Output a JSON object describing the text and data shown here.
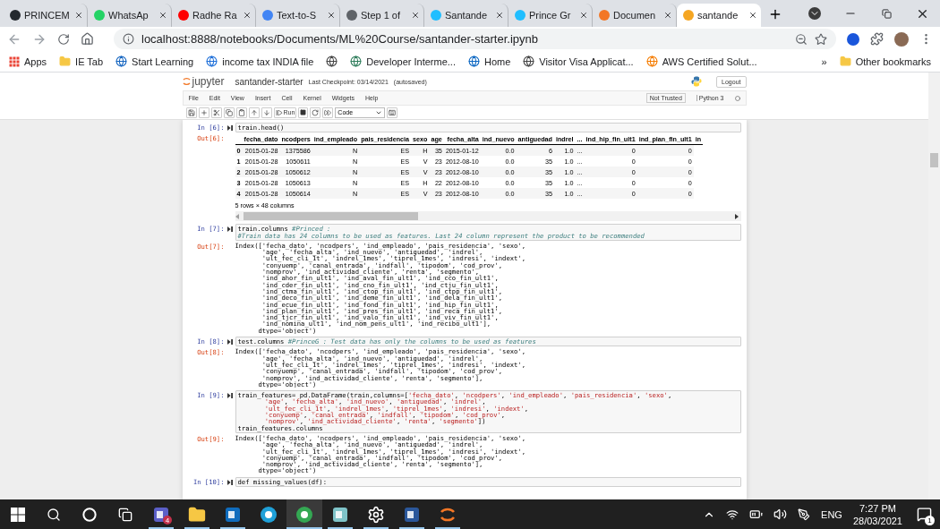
{
  "browser": {
    "tabs": [
      {
        "title": "PRINCEM",
        "color": "#24292e",
        "selected": false
      },
      {
        "title": "WhatsAp",
        "color": "#25d366",
        "selected": false
      },
      {
        "title": "Radhe Ra",
        "color": "#ff0000",
        "selected": false
      },
      {
        "title": "Text-to-S",
        "color": "#4285f4",
        "selected": false
      },
      {
        "title": "Step 1 of",
        "color": "#5f6368",
        "selected": false
      },
      {
        "title": "Santande",
        "color": "#20beff",
        "selected": false
      },
      {
        "title": "Prince Gr",
        "color": "#20beff",
        "selected": false
      },
      {
        "title": "Documen",
        "color": "#f37726",
        "selected": false
      },
      {
        "title": "santande",
        "color": "#f5a623",
        "selected": true
      }
    ],
    "address": "localhost:8888/notebooks/Documents/ML%20Course/santander-starter.ipynb",
    "bookmarks": [
      {
        "kind": "grid",
        "label": "Apps",
        "color": "#ea4335"
      },
      {
        "kind": "folder",
        "label": "IE Tab",
        "color": "#f6c744"
      },
      {
        "kind": "site",
        "label": "Start Learning",
        "color": "#1565c0"
      },
      {
        "kind": "site",
        "label": "income tax INDIA file",
        "color": "#1e6fd9"
      },
      {
        "kind": "site",
        "color": "#444444"
      },
      {
        "kind": "site",
        "label": "Developer Interme...",
        "color": "#2e7d5b"
      },
      {
        "kind": "site",
        "label": "Home",
        "color": "#0a66c2"
      },
      {
        "kind": "site",
        "label": "Visitor Visa Applicat...",
        "color": "#444444"
      },
      {
        "kind": "site",
        "label": "AWS Certified Solut...",
        "color": "#f57c00"
      }
    ],
    "more": "»",
    "other_bookmarks": "Other bookmarks"
  },
  "jupyter": {
    "logo": "jupyter",
    "name": "santander-starter",
    "checkpoint": "Last Checkpoint: 03/14/2021",
    "autosave": "(autosaved)",
    "logout": "Logout",
    "menu": [
      "File",
      "Edit",
      "View",
      "Insert",
      "Cell",
      "Kernel",
      "Widgets",
      "Help"
    ],
    "trust": "Not Trusted",
    "kernel": "Python 3",
    "run": "Run",
    "cell_type": "Code"
  },
  "cells": [
    {
      "prompt": "In [6]:",
      "code": [
        "train.head()"
      ],
      "output": {
        "prompt": "Out[6]:",
        "kind": "table",
        "columns": [
          "",
          "fecha_dato",
          "ncodpers",
          "ind_empleado",
          "pais_residencia",
          "sexo",
          "age",
          "fecha_alta",
          "ind_nuevo",
          "antiguedad",
          "indrel",
          "...",
          "ind_hip_fin_ult1",
          "ind_plan_fin_ult1",
          "in"
        ],
        "rows": [
          [
            "0",
            "2015-01-28",
            "1375586",
            "N",
            "ES",
            "H",
            "35",
            "2015-01-12",
            "0.0",
            "6",
            "1.0",
            "...",
            "0",
            "0"
          ],
          [
            "1",
            "2015-01-28",
            "1050611",
            "N",
            "ES",
            "V",
            "23",
            "2012-08-10",
            "0.0",
            "35",
            "1.0",
            "...",
            "0",
            "0"
          ],
          [
            "2",
            "2015-01-28",
            "1050612",
            "N",
            "ES",
            "V",
            "23",
            "2012-08-10",
            "0.0",
            "35",
            "1.0",
            "...",
            "0",
            "0"
          ],
          [
            "3",
            "2015-01-28",
            "1050613",
            "N",
            "ES",
            "H",
            "22",
            "2012-08-10",
            "0.0",
            "35",
            "1.0",
            "...",
            "0",
            "0"
          ],
          [
            "4",
            "2015-01-28",
            "1050614",
            "N",
            "ES",
            "V",
            "23",
            "2012-08-10",
            "0.0",
            "35",
            "1.0",
            "...",
            "0",
            "0"
          ]
        ],
        "summary": "5 rows × 48 columns"
      }
    },
    {
      "prompt": "In [7]:",
      "code": [
        "train.columns #Princed :",
        "#Train data has 24 columns to be used as features. Last 24 column represent the product to be recommended"
      ],
      "output": {
        "prompt": "Out[7]:",
        "kind": "text",
        "lines": [
          "Index(['fecha_dato', 'ncodpers', 'ind_empleado', 'pais_residencia', 'sexo',",
          "       'age', 'fecha_alta', 'ind_nuevo', 'antiguedad', 'indrel',",
          "       'ult_fec_cli_1t', 'indrel_1mes', 'tiprel_1mes', 'indresi', 'indext',",
          "       'conyuemp', 'canal_entrada', 'indfall', 'tipodom', 'cod_prov',",
          "       'nomprov', 'ind_actividad_cliente', 'renta', 'segmento',",
          "       'ind_ahor_fin_ult1', 'ind_aval_fin_ult1', 'ind_cco_fin_ult1',",
          "       'ind_cder_fin_ult1', 'ind_cno_fin_ult1', 'ind_ctju_fin_ult1',",
          "       'ind_ctma_fin_ult1', 'ind_ctop_fin_ult1', 'ind_ctpp_fin_ult1',",
          "       'ind_deco_fin_ult1', 'ind_deme_fin_ult1', 'ind_dela_fin_ult1',",
          "       'ind_ecue_fin_ult1', 'ind_fond_fin_ult1', 'ind_hip_fin_ult1',",
          "       'ind_plan_fin_ult1', 'ind_pres_fin_ult1', 'ind_reca_fin_ult1',",
          "       'ind_tjcr_fin_ult1', 'ind_valo_fin_ult1', 'ind_viv_fin_ult1',",
          "       'ind_nomina_ult1', 'ind_nom_pens_ult1', 'ind_recibo_ult1'],",
          "      dtype='object')"
        ]
      }
    },
    {
      "prompt": "In [8]:",
      "code": [
        "test.columns #PrinceG : Test data has only the columns to be used as features"
      ],
      "output": {
        "prompt": "Out[8]:",
        "kind": "text",
        "lines": [
          "Index(['fecha_dato', 'ncodpers', 'ind_empleado', 'pais_residencia', 'sexo',",
          "       'age', 'fecha_alta', 'ind_nuevo', 'antiguedad', 'indrel',",
          "       'ult_fec_cli_1t', 'indrel_1mes', 'tiprel_1mes', 'indresi', 'indext',",
          "       'conyuemp', 'canal_entrada', 'indfall', 'tipodom', 'cod_prov',",
          "       'nomprov', 'ind_actividad_cliente', 'renta', 'segmento'],",
          "      dtype='object')"
        ]
      }
    },
    {
      "prompt": "In [9]:",
      "code": [
        "train_features= pd.DataFrame(train,columns=['fecha_dato', 'ncodpers', 'ind_empleado', 'pais_residencia', 'sexo',",
        "       'age', 'fecha_alta', 'ind_nuevo', 'antiguedad', 'indrel',",
        "       'ult_fec_cli_1t', 'indrel_1mes', 'tiprel_1mes', 'indresi', 'indext',",
        "       'conyuemp', 'canal_entrada', 'indfall', 'tipodom', 'cod_prov',",
        "       'nomprov', 'ind_actividad_cliente', 'renta', 'segmento'])",
        "train_features.columns"
      ],
      "output": {
        "prompt": "Out[9]:",
        "kind": "text",
        "lines": [
          "Index(['fecha_dato', 'ncodpers', 'ind_empleado', 'pais_residencia', 'sexo',",
          "       'age', 'fecha_alta', 'ind_nuevo', 'antiguedad', 'indrel',",
          "       'ult_fec_cli_1t', 'indrel_1mes', 'tiprel_1mes', 'indresi', 'indext',",
          "       'conyuemp', 'canal_entrada', 'indfall', 'tipodom', 'cod_prov',",
          "       'nomprov', 'ind_actividad_cliente', 'renta', 'segmento'],",
          "      dtype='object')"
        ]
      }
    },
    {
      "prompt": "In [10]:",
      "code": [
        "def missing_values(df):"
      ]
    }
  ],
  "taskbar": {
    "apps": [
      {
        "kind": "tile",
        "color": "#5b5fc7",
        "badge": "4",
        "running": true,
        "selected": false
      },
      {
        "kind": "folder",
        "color": "#f6c744",
        "running": true,
        "selected": false
      },
      {
        "kind": "tile",
        "color": "#0f6cbd",
        "running": true,
        "selected": false
      },
      {
        "kind": "circle",
        "color": "#1fa0d8",
        "running": false,
        "selected": false
      },
      {
        "kind": "circle",
        "color": "#34a853",
        "running": true,
        "selected": true
      },
      {
        "kind": "tile",
        "color": "#7fc4c9",
        "running": true,
        "selected": false
      },
      {
        "kind": "gear",
        "color": "#ffffff",
        "running": true,
        "selected": false
      },
      {
        "kind": "tile",
        "color": "#2b579a",
        "running": true,
        "selected": false
      },
      {
        "kind": "arc",
        "color": "#f37726",
        "running": true,
        "selected": false
      }
    ],
    "language": "ENG",
    "time": "7:27 PM",
    "date": "28/03/2021",
    "notifications": "1"
  }
}
